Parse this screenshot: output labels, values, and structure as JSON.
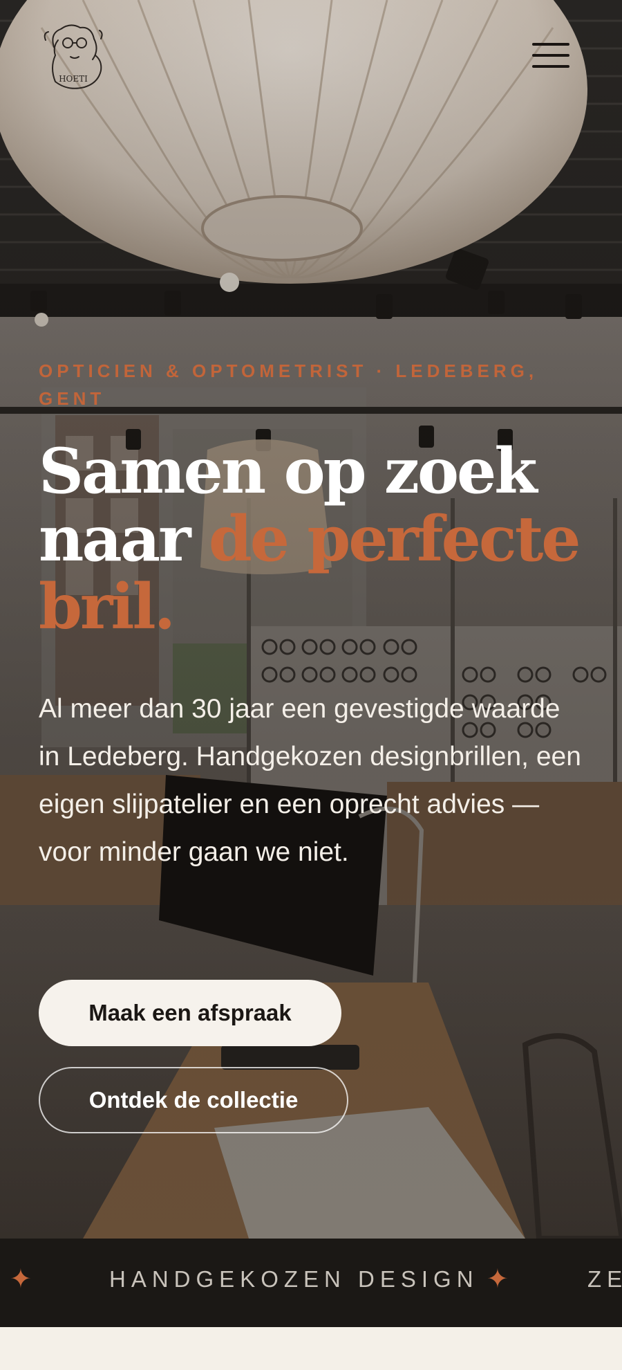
{
  "brand": {
    "logo_text": "HOETI",
    "accent_color": "#c6683b",
    "dark_color": "#1b1815"
  },
  "header": {
    "menu_icon": "hamburger-menu-icon"
  },
  "hero": {
    "eyebrow": "OPTICIEN & OPTOMETRIST · LEDEBERG, GENT",
    "headline_part1": "Samen op zoek naar ",
    "headline_accent": "de perfecte bril.",
    "lead": "Al meer dan 30 jaar een gevestigde waarde in Ledeberg. Handgekozen designbrillen, een eigen slijpatelier en een oprecht advies — voor minder gaan we niet.",
    "primary_cta": "Maak een afspraak",
    "secondary_cta": "Ontdek de collectie"
  },
  "marquee": {
    "separator_icon": "four-point-star-icon",
    "separator": "✦",
    "items": [
      "HANDGEKOZEN DESIGN",
      "ZE"
    ]
  }
}
